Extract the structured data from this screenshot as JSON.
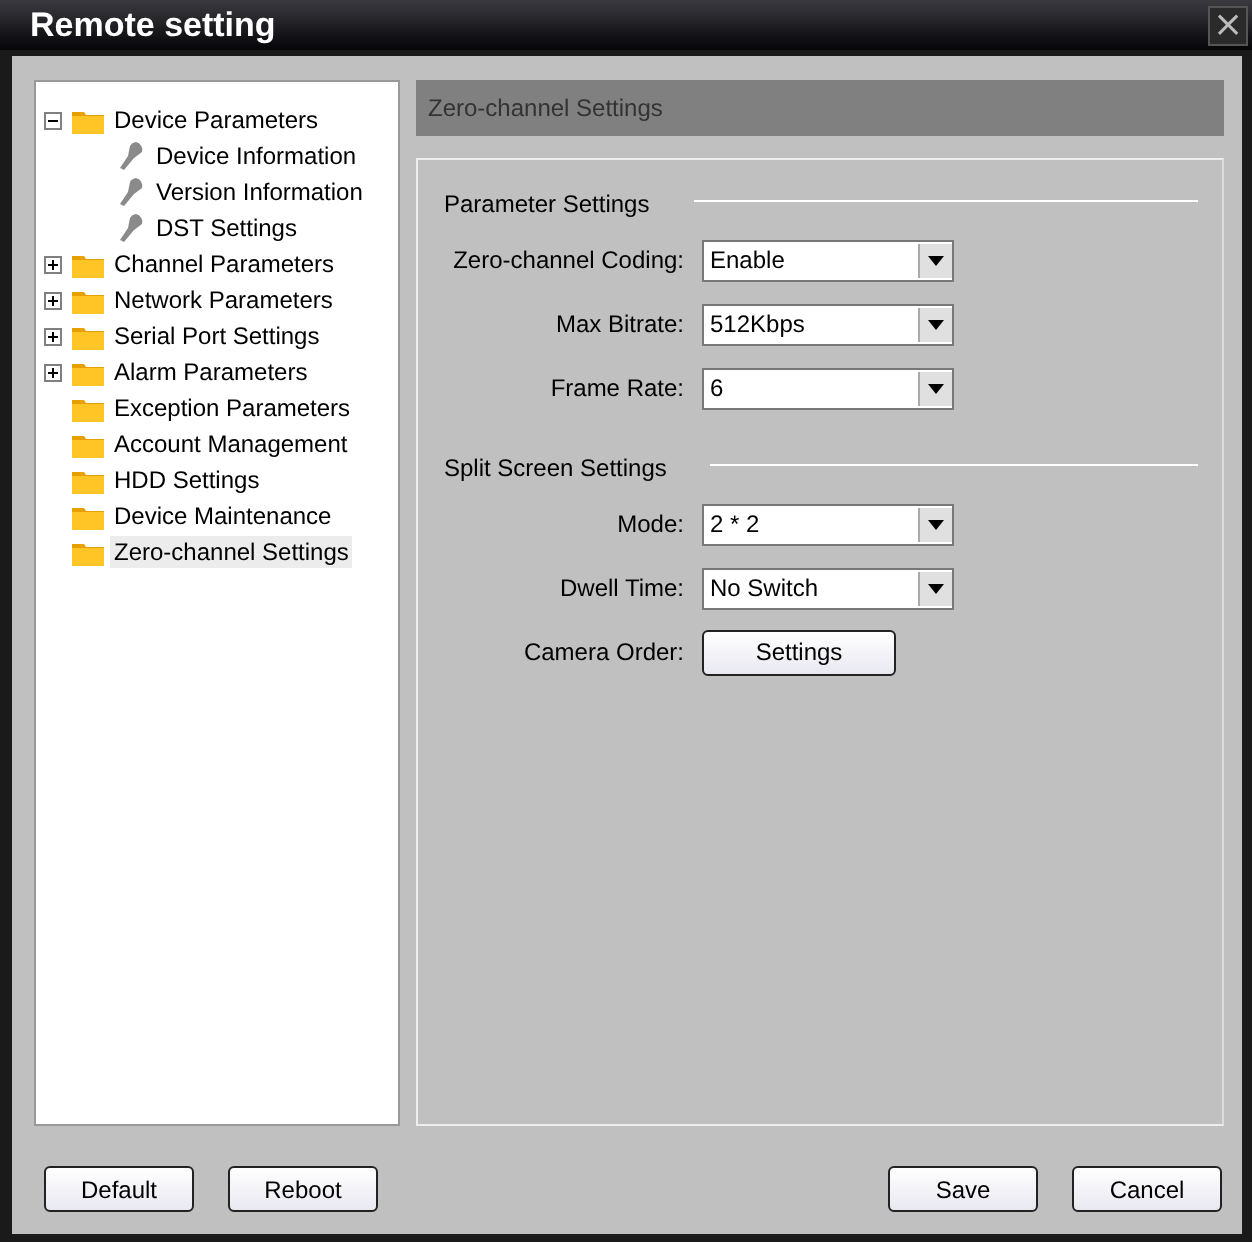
{
  "window": {
    "title": "Remote setting",
    "close": "×"
  },
  "tree": [
    {
      "label": "Device Parameters",
      "kind": "folder",
      "expanded": true,
      "selected": false,
      "children": [
        {
          "label": "Device Information",
          "kind": "wrench",
          "selected": false
        },
        {
          "label": "Version Information",
          "kind": "wrench",
          "selected": false
        },
        {
          "label": "DST Settings",
          "kind": "wrench",
          "selected": false
        }
      ]
    },
    {
      "label": "Channel Parameters",
      "kind": "folder",
      "expanded": false,
      "selected": false
    },
    {
      "label": "Network Parameters",
      "kind": "folder",
      "expanded": false,
      "selected": false
    },
    {
      "label": "Serial Port Settings",
      "kind": "folder",
      "expanded": false,
      "selected": false
    },
    {
      "label": "Alarm Parameters",
      "kind": "folder",
      "expanded": false,
      "selected": false
    },
    {
      "label": "Exception Parameters",
      "kind": "folder",
      "selected": false
    },
    {
      "label": "Account Management",
      "kind": "folder",
      "selected": false
    },
    {
      "label": "HDD Settings",
      "kind": "folder",
      "selected": false
    },
    {
      "label": "Device Maintenance",
      "kind": "folder",
      "selected": false
    },
    {
      "label": "Zero-channel Settings",
      "kind": "folder",
      "selected": true
    }
  ],
  "panel_title": "Zero-channel Settings",
  "sections": [
    {
      "title": "Parameter Settings",
      "fields": [
        {
          "label": "Zero-channel Coding:",
          "kind": "select",
          "value": "Enable"
        },
        {
          "label": "Max Bitrate:",
          "kind": "select",
          "value": "512Kbps"
        },
        {
          "label": "Frame Rate:",
          "kind": "select",
          "value": "6"
        }
      ]
    },
    {
      "title": "Split Screen Settings",
      "fields": [
        {
          "label": "Mode:",
          "kind": "select",
          "value": "2 * 2"
        },
        {
          "label": "Dwell Time:",
          "kind": "select",
          "value": "No Switch"
        },
        {
          "label": "Camera Order:",
          "kind": "button",
          "value": "Settings"
        }
      ]
    }
  ],
  "left_buttons": [
    "Default",
    "Reboot"
  ],
  "right_buttons": [
    "Save",
    "Cancel"
  ]
}
